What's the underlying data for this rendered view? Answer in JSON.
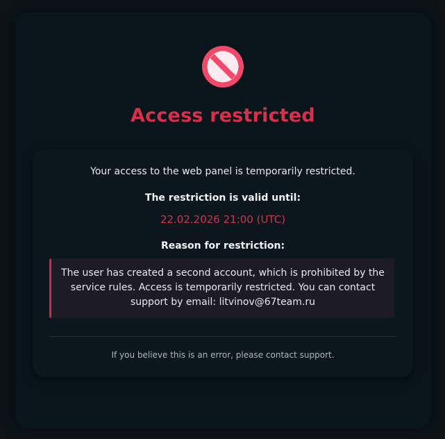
{
  "header": {
    "icon": "prohibited-icon",
    "title": "Access restricted"
  },
  "details": {
    "intro": "Your access to the web panel is temporarily restricted.",
    "until_label": "The restriction is valid until:",
    "until_value": "22.02.2026 21:00 (UTC)",
    "reason_label": "Reason for restriction:",
    "reason_text": "The user has created a second account, which is prohibited by the service rules. Access is temporarily restricted. You can contact support by email: litvinov@67team.ru",
    "footnote": "If you believe this is an error, please contact support."
  },
  "colors": {
    "accent": "#d8304b",
    "background": "#0a151b",
    "reason_box": "#1c1b26"
  }
}
